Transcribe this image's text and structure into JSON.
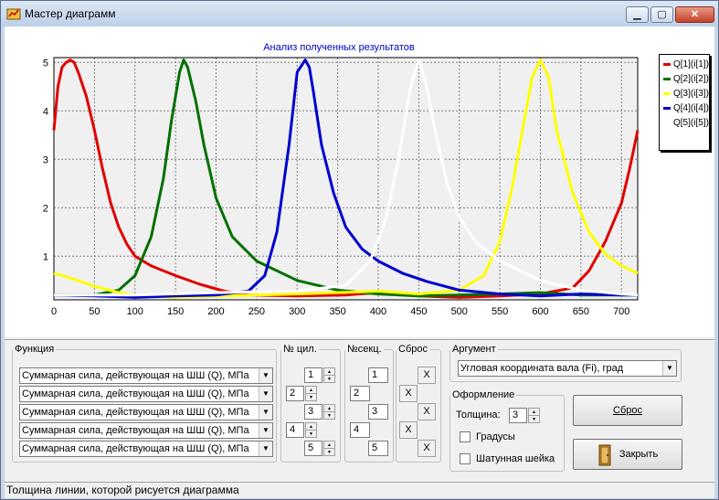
{
  "window": {
    "title": "Мастер диаграмм",
    "minimize": "▁",
    "maximize": "▢",
    "close": "✕"
  },
  "chart_data": {
    "type": "line",
    "title": "Анализ полученных результатов",
    "xlim": [
      0,
      720
    ],
    "ylim": [
      0.1,
      5.1
    ],
    "xticks": [
      0,
      50,
      100,
      150,
      200,
      250,
      300,
      350,
      400,
      450,
      500,
      550,
      600,
      650,
      700
    ],
    "yticks": [
      1,
      2,
      3,
      4,
      5
    ],
    "grid": true,
    "legend_position": "right",
    "series": [
      {
        "name": "Q[1](i[1])",
        "color": "#e00000",
        "x": [
          0,
          5,
          10,
          15,
          20,
          25,
          30,
          40,
          50,
          60,
          70,
          80,
          90,
          100,
          120,
          150,
          180,
          210,
          240,
          300,
          360,
          400,
          450,
          500,
          550,
          600,
          640,
          660,
          680,
          700,
          710,
          720
        ],
        "y": [
          3.6,
          4.5,
          4.9,
          5.0,
          5.05,
          5.0,
          4.8,
          4.3,
          3.6,
          2.8,
          2.1,
          1.6,
          1.25,
          1.0,
          0.8,
          0.6,
          0.42,
          0.28,
          0.2,
          0.18,
          0.2,
          0.25,
          0.18,
          0.15,
          0.18,
          0.22,
          0.35,
          0.7,
          1.3,
          2.1,
          2.8,
          3.6
        ]
      },
      {
        "name": "Q[2](i[2])",
        "color": "#007000",
        "x": [
          0,
          50,
          80,
          100,
          120,
          135,
          145,
          155,
          160,
          165,
          175,
          185,
          200,
          220,
          250,
          300,
          350,
          400,
          450,
          500,
          550,
          600,
          650,
          700,
          720
        ],
        "y": [
          0.2,
          0.2,
          0.3,
          0.6,
          1.4,
          2.6,
          3.8,
          4.8,
          5.05,
          4.9,
          4.2,
          3.3,
          2.2,
          1.4,
          0.9,
          0.5,
          0.3,
          0.22,
          0.18,
          0.2,
          0.22,
          0.25,
          0.2,
          0.2,
          0.2
        ]
      },
      {
        "name": "Q[3](i[3])",
        "color": "#ffff00",
        "x": [
          0,
          20,
          50,
          80,
          110,
          150,
          200,
          250,
          300,
          350,
          400,
          450,
          500,
          530,
          550,
          565,
          580,
          590,
          600,
          610,
          620,
          640,
          660,
          680,
          700,
          720
        ],
        "y": [
          0.65,
          0.55,
          0.38,
          0.25,
          0.18,
          0.15,
          0.18,
          0.2,
          0.22,
          0.25,
          0.28,
          0.22,
          0.3,
          0.6,
          1.3,
          2.4,
          3.8,
          4.7,
          5.05,
          4.7,
          3.6,
          2.3,
          1.5,
          1.05,
          0.8,
          0.65
        ]
      },
      {
        "name": "Q[4](i[4])",
        "color": "#0000d0",
        "x": [
          0,
          50,
          100,
          150,
          200,
          240,
          260,
          275,
          290,
          300,
          310,
          315,
          320,
          330,
          345,
          360,
          380,
          400,
          430,
          460,
          500,
          550,
          600,
          650,
          700,
          720
        ],
        "y": [
          0.2,
          0.18,
          0.15,
          0.18,
          0.2,
          0.28,
          0.6,
          1.5,
          3.3,
          4.8,
          5.05,
          4.9,
          4.4,
          3.3,
          2.3,
          1.6,
          1.15,
          0.9,
          0.65,
          0.48,
          0.3,
          0.22,
          0.18,
          0.22,
          0.2,
          0.2
        ]
      },
      {
        "name": "Q[5](i[5])",
        "color": "#ffffff",
        "x": [
          0,
          100,
          200,
          300,
          360,
          390,
          410,
          425,
          440,
          450,
          460,
          470,
          485,
          500,
          520,
          550,
          600,
          650,
          700,
          720
        ],
        "y": [
          0.2,
          0.2,
          0.25,
          0.28,
          0.4,
          0.9,
          1.8,
          3.0,
          4.5,
          5.05,
          4.5,
          3.6,
          2.5,
          1.8,
          1.3,
          0.9,
          0.5,
          0.3,
          0.22,
          0.2
        ]
      }
    ]
  },
  "function_group": {
    "legend": "Функция",
    "rows": [
      "Суммарная сила, действующая на ШШ (Q), МПа",
      "Суммарная сила, действующая на ШШ (Q), МПа",
      "Суммарная сила, действующая на ШШ (Q), МПа",
      "Суммарная сила, действующая на ШШ (Q), МПа",
      "Суммарная сила, действующая на ШШ (Q), МПа"
    ]
  },
  "cyl_group": {
    "legend": "№ цил.",
    "values": [
      "1",
      "2",
      "3",
      "4",
      "5"
    ]
  },
  "sect_group": {
    "legend": "№секц.",
    "values": [
      "1",
      "2",
      "3",
      "4",
      "5"
    ]
  },
  "reset_group": {
    "legend": "Сброс",
    "label": "X"
  },
  "argument_group": {
    "legend": "Аргумент",
    "value": "Угловая координата вала (Fi), град"
  },
  "style_group": {
    "legend": "Оформление",
    "thickness_label": "Толщина:",
    "thickness_value": "3",
    "degrees_label": "Градусы",
    "journal_label": "Шатунная шейка"
  },
  "buttons": {
    "reset": "Сброс",
    "close": "Закрыть"
  },
  "status": "Толщина линии, которой рисуется диаграмма"
}
